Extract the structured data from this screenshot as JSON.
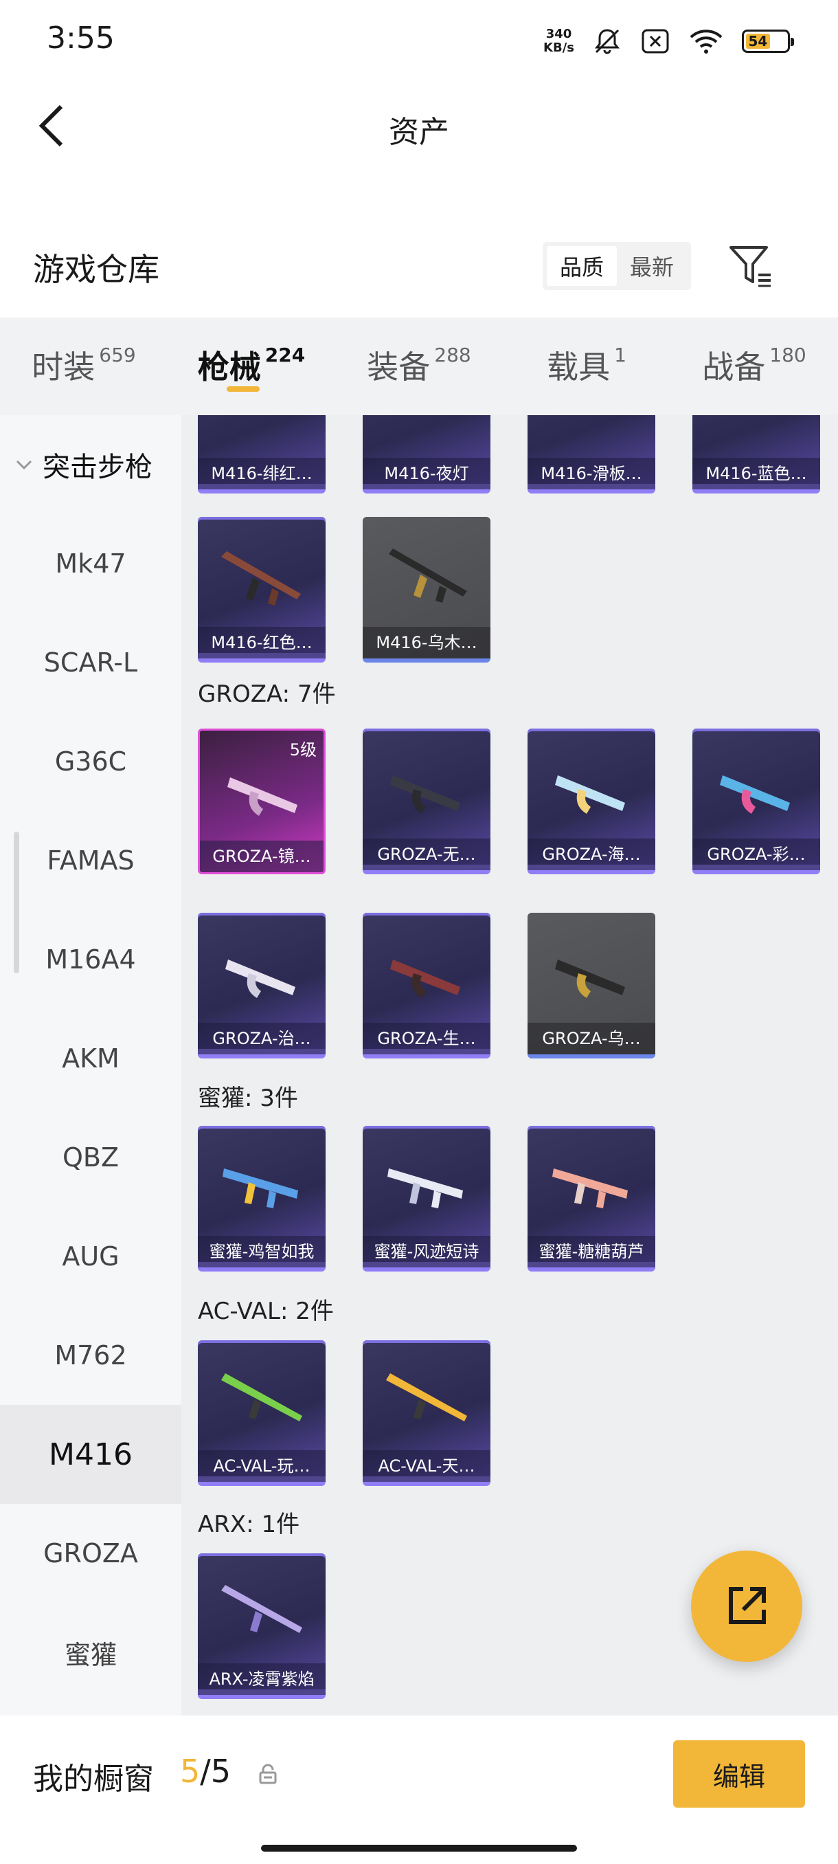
{
  "status": {
    "time": "3:55",
    "net_speed_top": "340",
    "net_speed_bottom": "KB/s",
    "battery": "54"
  },
  "header": {
    "title": "资产"
  },
  "section": {
    "title": "游戏仓库",
    "sort_options": [
      "品质",
      "最新"
    ]
  },
  "tabs": [
    {
      "label": "时装",
      "count": "659"
    },
    {
      "label": "枪械",
      "count": "224"
    },
    {
      "label": "装备",
      "count": "288"
    },
    {
      "label": "载具",
      "count": "1"
    },
    {
      "label": "战备",
      "count": "180"
    }
  ],
  "sidebar": {
    "group": "突击步枪",
    "items": [
      "Mk47",
      "SCAR-L",
      "G36C",
      "FAMAS",
      "M16A4",
      "AKM",
      "QBZ",
      "AUG",
      "M762",
      "M416",
      "GROZA",
      "蜜獾"
    ]
  },
  "content": {
    "m416_row1": [
      "M416-绯红…",
      "M416-夜灯",
      "M416-滑板…",
      "M416-蓝色…"
    ],
    "m416_row2": [
      "M416-红色…",
      "M416-乌木…"
    ],
    "groza_title": "GROZA: 7件",
    "groza_level": "5级",
    "groza_row1": [
      "GROZA-镜…",
      "GROZA-无…",
      "GROZA-海…",
      "GROZA-彩…"
    ],
    "groza_row2": [
      "GROZA-治…",
      "GROZA-生…",
      "GROZA-乌…"
    ],
    "honey_title": "蜜獾: 3件",
    "honey_row": [
      "蜜獾-鸡智如我",
      "蜜獾-风迹短诗",
      "蜜獾-糖糖葫芦"
    ],
    "acval_title": "AC-VAL: 2件",
    "acval_row": [
      "AC-VAL-玩…",
      "AC-VAL-天…"
    ],
    "arx_title": "ARX: 1件",
    "arx_row": [
      "ARX-凌霄紫焰"
    ]
  },
  "bottom": {
    "showcase_label": "我的橱窗",
    "count_current": "5",
    "count_sep": "/",
    "count_total": "5",
    "edit_label": "编辑"
  },
  "colors": {
    "accent": "#f2b638",
    "card_purple": "#2c2a52",
    "card_rare": "#d33bc4"
  }
}
